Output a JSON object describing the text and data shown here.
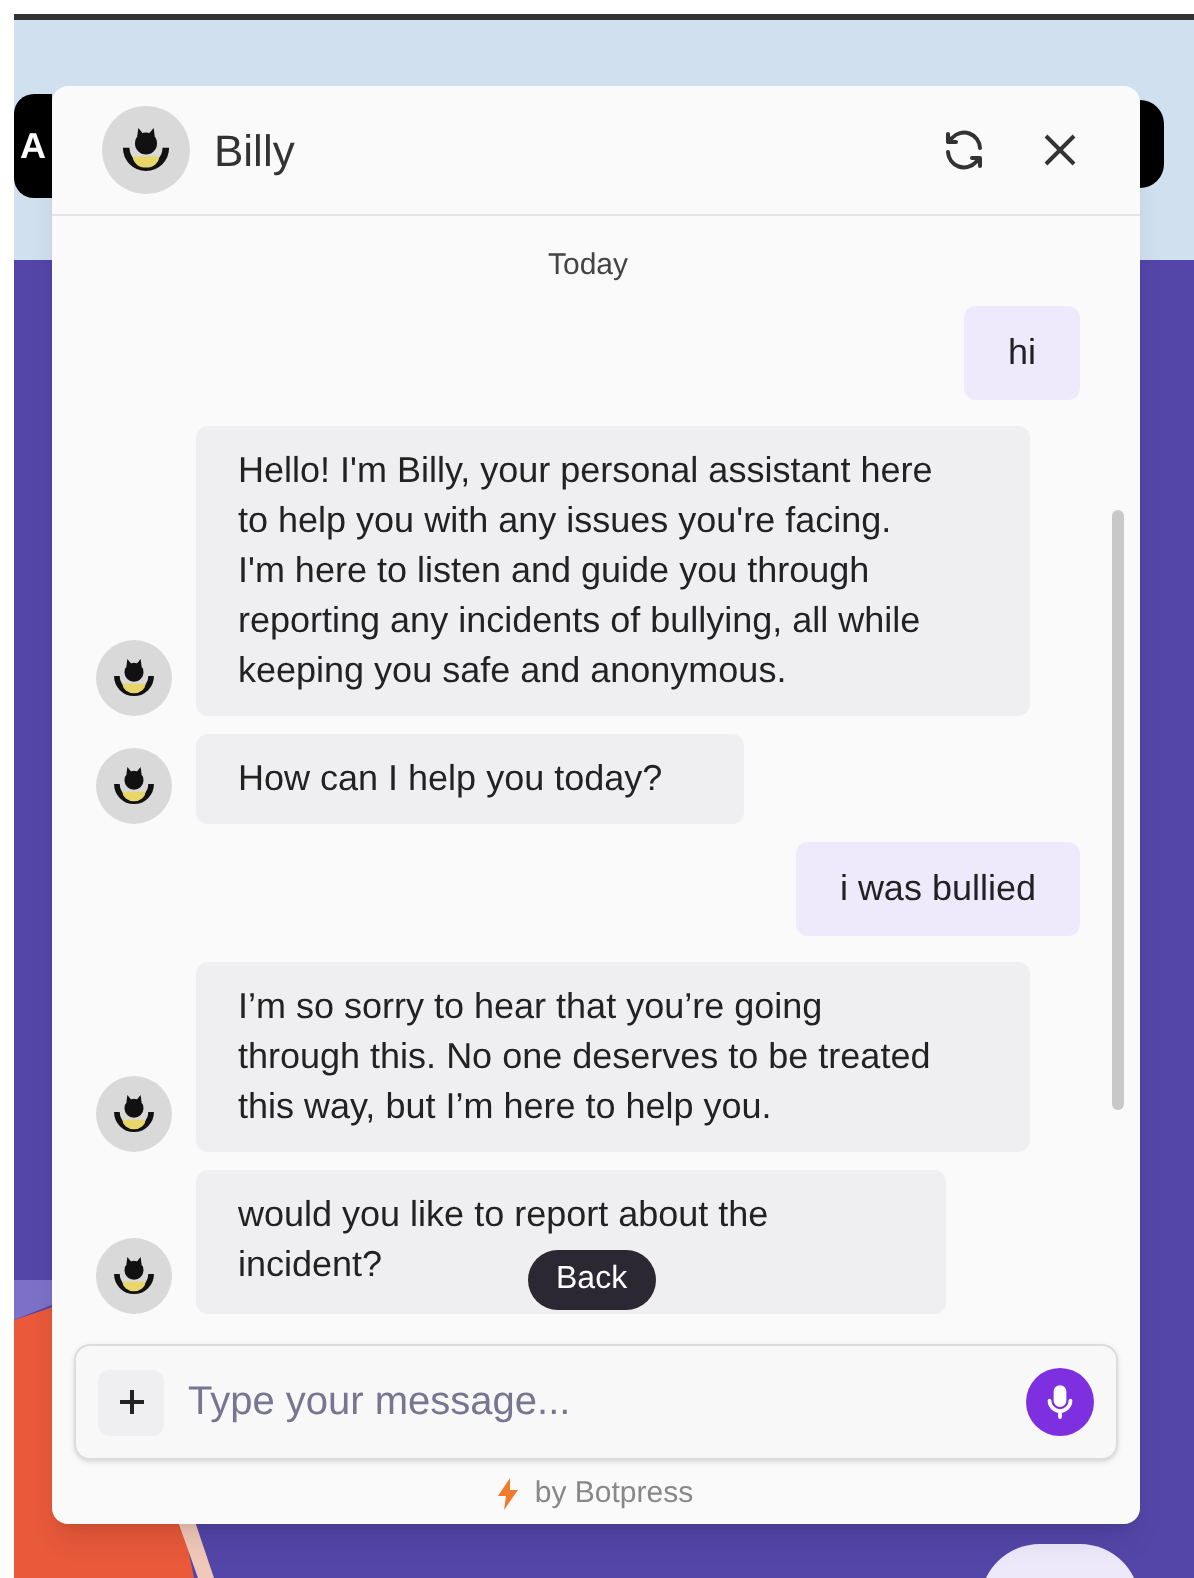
{
  "background": {
    "button_label": "A"
  },
  "header": {
    "title": "Billy"
  },
  "date_divider": "Today",
  "messages": [
    {
      "kind": "user",
      "text": "hi"
    },
    {
      "kind": "bot",
      "text": "Hello! I'm Billy, your personal assistant here to help you with any issues you're facing. I'm here to listen and guide you through reporting any incidents of bullying, all while keeping you safe and anonymous."
    },
    {
      "kind": "bot",
      "text": "How can I help you today?"
    },
    {
      "kind": "user",
      "text": "i was bullied"
    },
    {
      "kind": "bot",
      "text": "I’m so sorry to hear that you’re going through this. No one deserves to be treated this way, but I’m here to help you."
    },
    {
      "kind": "bot",
      "text": "would you like to report about the incident?"
    }
  ],
  "back_button": "Back",
  "composer": {
    "placeholder": "Type your message..."
  },
  "footer": "by Botpress"
}
